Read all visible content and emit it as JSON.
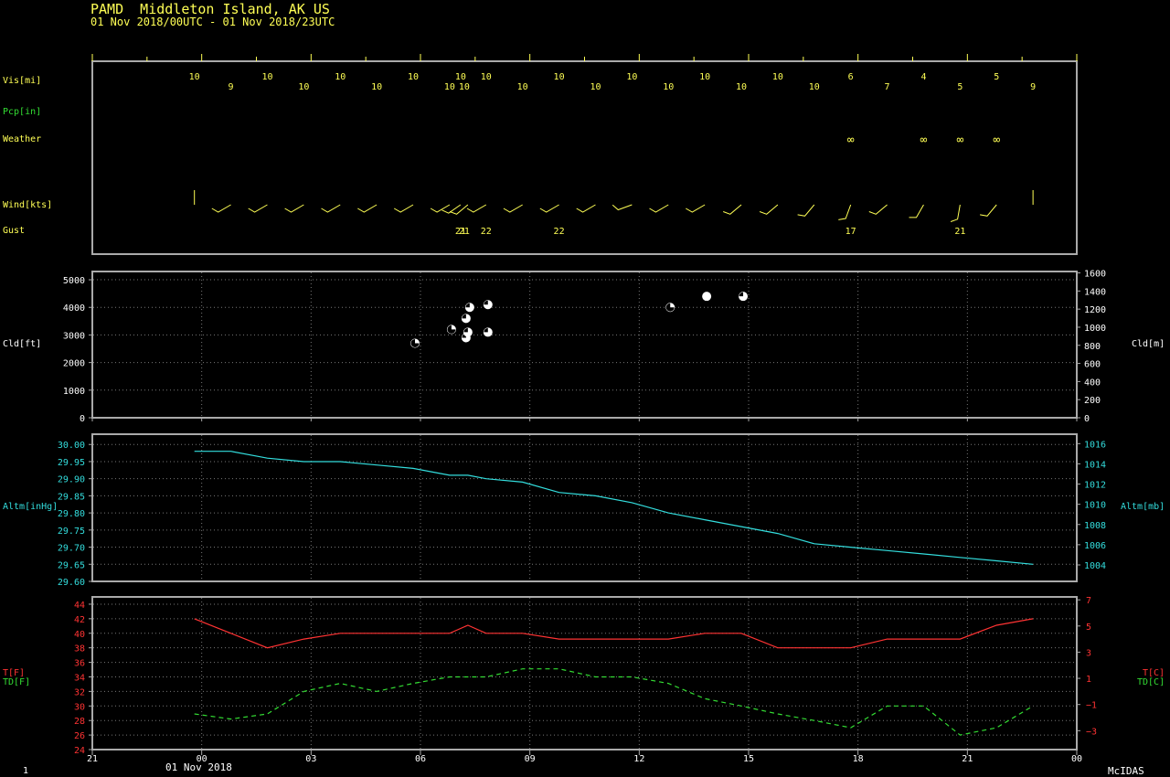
{
  "header": {
    "station": "PAMD  Middleton Island, AK US",
    "range": "01 Nov 2018/00UTC - 01 Nov 2018/23UTC"
  },
  "labels": {
    "vis": "Vis[mi]",
    "pcp": "Pcp[in]",
    "weather": "Weather",
    "wind": "Wind[kts]",
    "gust": "Gust",
    "cld_left": "Cld[ft]",
    "cld_right": "Cld[m]",
    "altm_left": "Altm[inHg]",
    "altm_right": "Altm[mb]",
    "t_f": "T[F]",
    "td_f": "TD[F]",
    "t_c": "T[C]",
    "td_c": "TD[C]"
  },
  "footer": {
    "frame": "1",
    "date": "01 Nov 2018",
    "brand": "McIDAS"
  },
  "colors": {
    "yellow": "#ffff55",
    "green": "#33dd33",
    "cyan": "#33dddd",
    "red": "#ff3333",
    "frame": "#aaaaaa",
    "white": "#ffffff"
  },
  "chart_data": {
    "type": "line",
    "x_axis": {
      "unit": "hour UTC",
      "range": [
        -3,
        24
      ],
      "ticks": [
        -3,
        0,
        3,
        6,
        9,
        12,
        15,
        18,
        21,
        24
      ],
      "tick_labels": [
        "21",
        "00",
        "03",
        "06",
        "09",
        "12",
        "15",
        "18",
        "21",
        "00"
      ]
    },
    "visibility": [
      {
        "h": -0.2,
        "v": "10"
      },
      {
        "h": 0.8,
        "v": "9"
      },
      {
        "h": 1.8,
        "v": "10"
      },
      {
        "h": 2.8,
        "v": "10"
      },
      {
        "h": 3.8,
        "v": "10"
      },
      {
        "h": 4.8,
        "v": "10"
      },
      {
        "h": 5.8,
        "v": "10"
      },
      {
        "h": 6.8,
        "v": "10"
      },
      {
        "h": 7.1,
        "v": "10"
      },
      {
        "h": 7.2,
        "v": "10"
      },
      {
        "h": 7.8,
        "v": "10"
      },
      {
        "h": 8.8,
        "v": "10"
      },
      {
        "h": 9.8,
        "v": "10"
      },
      {
        "h": 10.8,
        "v": "10"
      },
      {
        "h": 11.8,
        "v": "10"
      },
      {
        "h": 12.8,
        "v": "10"
      },
      {
        "h": 13.8,
        "v": "10"
      },
      {
        "h": 14.8,
        "v": "10"
      },
      {
        "h": 15.8,
        "v": "10"
      },
      {
        "h": 16.8,
        "v": "10"
      },
      {
        "h": 17.8,
        "v": "6"
      },
      {
        "h": 18.8,
        "v": "7"
      },
      {
        "h": 19.8,
        "v": "4"
      },
      {
        "h": 20.8,
        "v": "5"
      },
      {
        "h": 21.8,
        "v": "5"
      },
      {
        "h": 22.8,
        "v": "9"
      }
    ],
    "weather": [
      {
        "h": 17.8,
        "symbol": "∞"
      },
      {
        "h": 19.8,
        "symbol": "∞"
      },
      {
        "h": 20.8,
        "symbol": "∞"
      },
      {
        "h": 21.8,
        "symbol": "∞"
      }
    ],
    "wind": [
      {
        "h": -0.2,
        "dir": 0,
        "calm": true
      },
      {
        "h": 0.8,
        "dir": 240
      },
      {
        "h": 1.8,
        "dir": 240
      },
      {
        "h": 2.8,
        "dir": 240
      },
      {
        "h": 3.8,
        "dir": 240
      },
      {
        "h": 4.8,
        "dir": 240
      },
      {
        "h": 5.8,
        "dir": 240
      },
      {
        "h": 6.8,
        "dir": 240
      },
      {
        "h": 7.1,
        "dir": 235
      },
      {
        "h": 7.3,
        "dir": 230
      },
      {
        "h": 7.8,
        "dir": 240
      },
      {
        "h": 8.8,
        "dir": 240
      },
      {
        "h": 9.8,
        "dir": 240
      },
      {
        "h": 10.8,
        "dir": 240
      },
      {
        "h": 11.8,
        "dir": 250
      },
      {
        "h": 12.8,
        "dir": 240
      },
      {
        "h": 13.8,
        "dir": 240
      },
      {
        "h": 14.8,
        "dir": 230
      },
      {
        "h": 15.8,
        "dir": 230
      },
      {
        "h": 16.8,
        "dir": 220
      },
      {
        "h": 17.8,
        "dir": 200
      },
      {
        "h": 18.8,
        "dir": 230
      },
      {
        "h": 19.8,
        "dir": 210
      },
      {
        "h": 20.8,
        "dir": 190
      },
      {
        "h": 21.8,
        "dir": 220
      },
      {
        "h": 22.8,
        "dir": 0,
        "calm": true
      }
    ],
    "gust": [
      {
        "h": 7.1,
        "v": "21"
      },
      {
        "h": 7.2,
        "v": "21"
      },
      {
        "h": 7.8,
        "v": "22"
      },
      {
        "h": 9.8,
        "v": "22"
      },
      {
        "h": 17.8,
        "v": "17"
      },
      {
        "h": 20.8,
        "v": "21"
      }
    ],
    "cloud": {
      "ylim_ft": [
        0,
        5300
      ],
      "ft_ticks": [
        0,
        1000,
        2000,
        3000,
        4000,
        5000
      ],
      "m_ticks": [
        0,
        200,
        400,
        600,
        800,
        1000,
        1200,
        1400,
        1600
      ],
      "points": [
        {
          "h": 5.85,
          "ft": 2700,
          "cover": "sct"
        },
        {
          "h": 6.85,
          "ft": 3200,
          "cover": "sct"
        },
        {
          "h": 7.25,
          "ft": 2900,
          "cover": "bkn"
        },
        {
          "h": 7.3,
          "ft": 3100,
          "cover": "bkn"
        },
        {
          "h": 7.25,
          "ft": 3600,
          "cover": "bkn"
        },
        {
          "h": 7.35,
          "ft": 4000,
          "cover": "bkn"
        },
        {
          "h": 7.85,
          "ft": 3100,
          "cover": "bkn"
        },
        {
          "h": 7.85,
          "ft": 4100,
          "cover": "bkn"
        },
        {
          "h": 12.85,
          "ft": 4000,
          "cover": "sct"
        },
        {
          "h": 13.85,
          "ft": 4400,
          "cover": "ovc"
        },
        {
          "h": 14.85,
          "ft": 4400,
          "cover": "bkn"
        }
      ]
    },
    "altimeter": {
      "ylim_inhg": [
        29.6,
        30.03
      ],
      "inhg_ticks": [
        29.6,
        29.65,
        29.7,
        29.75,
        29.8,
        29.85,
        29.9,
        29.95,
        30.0
      ],
      "inhg_tick_labels": [
        "29.60",
        "29.65",
        "29.70",
        "29.75",
        "29.80",
        "29.85",
        "29.90",
        "29.95",
        "30.00"
      ],
      "mb_ticks": [
        1004,
        1006,
        1008,
        1010,
        1012,
        1014,
        1016
      ],
      "x": [
        -0.2,
        0.8,
        1.8,
        2.8,
        3.8,
        4.8,
        5.8,
        6.8,
        7.3,
        7.8,
        8.8,
        9.8,
        10.8,
        11.8,
        12.8,
        13.8,
        14.8,
        15.8,
        16.8,
        17.8,
        18.8,
        19.8,
        20.8,
        21.8,
        22.8
      ],
      "y": [
        29.98,
        29.98,
        29.96,
        29.95,
        29.95,
        29.94,
        29.93,
        29.91,
        29.91,
        29.9,
        29.89,
        29.86,
        29.85,
        29.83,
        29.8,
        29.78,
        29.76,
        29.74,
        29.71,
        29.7,
        29.69,
        29.68,
        29.67,
        29.66,
        29.65
      ]
    },
    "temperature": {
      "ylim_f": [
        24,
        45
      ],
      "f_ticks": [
        24,
        26,
        28,
        30,
        32,
        34,
        36,
        38,
        40,
        42,
        44
      ],
      "c_ticks": [
        -3,
        -1,
        1,
        3,
        5,
        7
      ],
      "c_tick_labels": [
        "−3",
        "−1",
        "1",
        "3",
        "5",
        "7"
      ],
      "series": [
        {
          "key": "T",
          "x": [
            -0.2,
            0.8,
            1.8,
            2.8,
            3.8,
            4.8,
            5.8,
            6.8,
            7.3,
            7.8,
            8.8,
            9.8,
            10.8,
            11.8,
            12.8,
            13.8,
            14.8,
            15.8,
            16.8,
            17.8,
            18.8,
            19.8,
            20.8,
            21.8,
            22.8
          ],
          "y": [
            42,
            40,
            38,
            39.2,
            40,
            40,
            40,
            40,
            41.1,
            40,
            40,
            39.2,
            39.2,
            39.2,
            39.2,
            40,
            40,
            38,
            38,
            38,
            39.2,
            39.2,
            39.2,
            41.1,
            42
          ]
        },
        {
          "key": "TD",
          "x": [
            -0.2,
            0.8,
            1.8,
            2.8,
            3.8,
            4.8,
            5.8,
            6.8,
            7.3,
            7.8,
            8.8,
            9.8,
            10.8,
            11.8,
            12.8,
            13.8,
            14.8,
            15.8,
            16.8,
            17.8,
            18.8,
            19.8,
            20.8,
            21.8,
            22.8
          ],
          "y": [
            28.9,
            28.2,
            28.9,
            32,
            33.1,
            32,
            33.1,
            34,
            34,
            34,
            35.1,
            35.1,
            34,
            34,
            33.1,
            31,
            30,
            28.9,
            28,
            27,
            30,
            30,
            26,
            27,
            30
          ]
        }
      ]
    }
  }
}
